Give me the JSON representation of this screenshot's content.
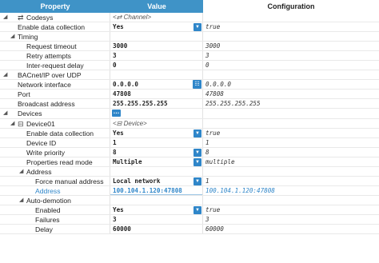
{
  "header": {
    "property": "Property",
    "value": "Value",
    "configuration": "Configuration"
  },
  "rows": [
    {
      "label": "Codesys",
      "level": 0,
      "toggle": "expanded",
      "icon": "sync-arrows-icon",
      "value": "<⇄ Channel>",
      "value_style": "italic",
      "config": ""
    },
    {
      "label": "Enable data collection",
      "level": 1,
      "value": "Yes",
      "control": "dropdown",
      "config": "true"
    },
    {
      "label": "Timing",
      "level": 1,
      "toggle": "expanded",
      "value": "",
      "config": ""
    },
    {
      "label": "Request timeout",
      "level": 2,
      "value": "3000",
      "config": "3000"
    },
    {
      "label": "Retry attempts",
      "level": 2,
      "value": "3",
      "config": "3"
    },
    {
      "label": "Inter-request delay",
      "level": 2,
      "value": "0",
      "config": "0"
    },
    {
      "label": "BACnet/IP over UDP",
      "level": 0,
      "toggle": "expanded",
      "value": "",
      "config": ""
    },
    {
      "label": "Network interface",
      "level": 1,
      "value": "0.0.0.0",
      "control": "network",
      "config": "0.0.0.0"
    },
    {
      "label": "Port",
      "level": 1,
      "value": "47808",
      "config": "47808"
    },
    {
      "label": "Broadcast address",
      "level": 1,
      "value": "255.255.255.255",
      "config": "255.255.255.255"
    },
    {
      "label": "Devices",
      "level": 0,
      "toggle": "expanded",
      "value": "",
      "control": "more",
      "config": ""
    },
    {
      "label": "Device01",
      "level": 1,
      "toggle": "expanded",
      "icon": "device-icon",
      "value": "<⊟ Device>",
      "value_style": "italic",
      "config": ""
    },
    {
      "label": "Enable data collection",
      "level": 2,
      "value": "Yes",
      "control": "dropdown",
      "config": "true"
    },
    {
      "label": "Device ID",
      "level": 2,
      "value": "1",
      "config": "1"
    },
    {
      "label": "Write priority",
      "level": 2,
      "value": "8",
      "control": "dropdown",
      "config": "8"
    },
    {
      "label": "Properties read mode",
      "level": 2,
      "value": "Multiple",
      "control": "dropdown",
      "config": "multiple"
    },
    {
      "label": "Address",
      "level": 2,
      "toggle": "expanded",
      "value": "",
      "config": ""
    },
    {
      "label": "Force manual address",
      "level": 3,
      "value": "Local network",
      "control": "dropdown",
      "config": "1"
    },
    {
      "label": "Address",
      "level": 3,
      "value": "100.104.1.120:47808",
      "style": "link",
      "config": "100.104.1.120:47808"
    },
    {
      "label": "Auto-demotion",
      "level": 2,
      "toggle": "expanded",
      "value": "",
      "config": ""
    },
    {
      "label": "Enabled",
      "level": 3,
      "value": "Yes",
      "control": "dropdown",
      "config": "true"
    },
    {
      "label": "Failures",
      "level": 3,
      "value": "3",
      "config": "3"
    },
    {
      "label": "Delay",
      "level": 3,
      "value": "60000",
      "config": "60000"
    }
  ]
}
